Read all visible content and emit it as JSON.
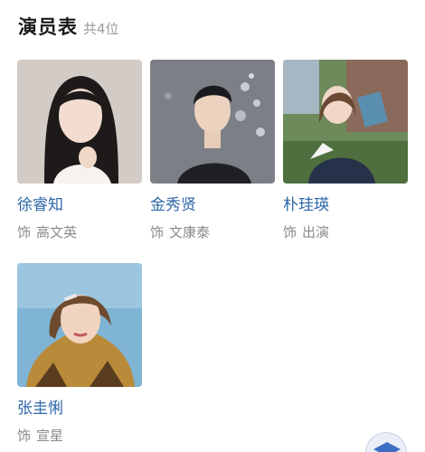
{
  "header": {
    "title": "演员表",
    "count": "共4位"
  },
  "cast": [
    {
      "name": "徐睿知",
      "role_prefix": "饰",
      "role": "高文英"
    },
    {
      "name": "金秀贤",
      "role_prefix": "饰",
      "role": "文康泰"
    },
    {
      "name": "朴珪瑛",
      "role_prefix": "饰",
      "role": "出演"
    },
    {
      "name": "张圭悧",
      "role_prefix": "饰",
      "role": "宣星"
    }
  ],
  "colors": {
    "name": "#2f67a8",
    "title": "#1a1a1a",
    "muted": "#8a8a8a"
  },
  "icons": {
    "float_button": "graduation-cap-icon"
  }
}
